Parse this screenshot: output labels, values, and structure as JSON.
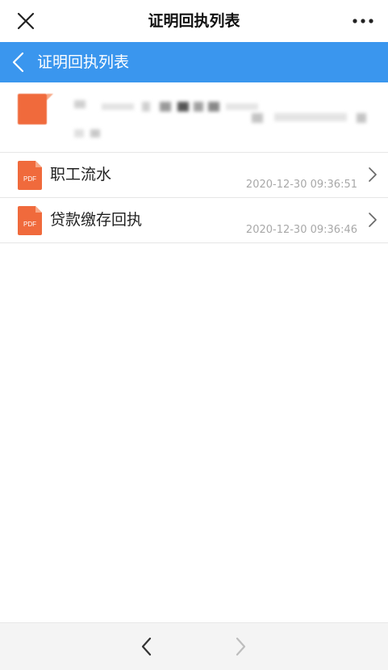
{
  "window": {
    "title": "证明回执列表"
  },
  "header": {
    "title": "证明回执列表"
  },
  "records": [
    {
      "label": "职工流水",
      "timestamp": "2020-12-30 09:36:51",
      "icon_text": "PDF"
    },
    {
      "label": "贷款缴存回执",
      "timestamp": "2020-12-30 09:36:46",
      "icon_text": "PDF"
    }
  ],
  "colors": {
    "header_blue": "#3a96ee",
    "pdf_orange": "#f06a3c",
    "timestamp_gray": "#a8a8a8",
    "bottom_bar": "#f4f4f4"
  },
  "icons": {
    "close": "close-icon",
    "more": "more-dots-icon",
    "back": "chevron-left-icon",
    "file": "pdf-icon",
    "row_arrow": "chevron-right-icon",
    "nav_back": "chevron-left-icon",
    "nav_forward": "chevron-right-icon"
  }
}
